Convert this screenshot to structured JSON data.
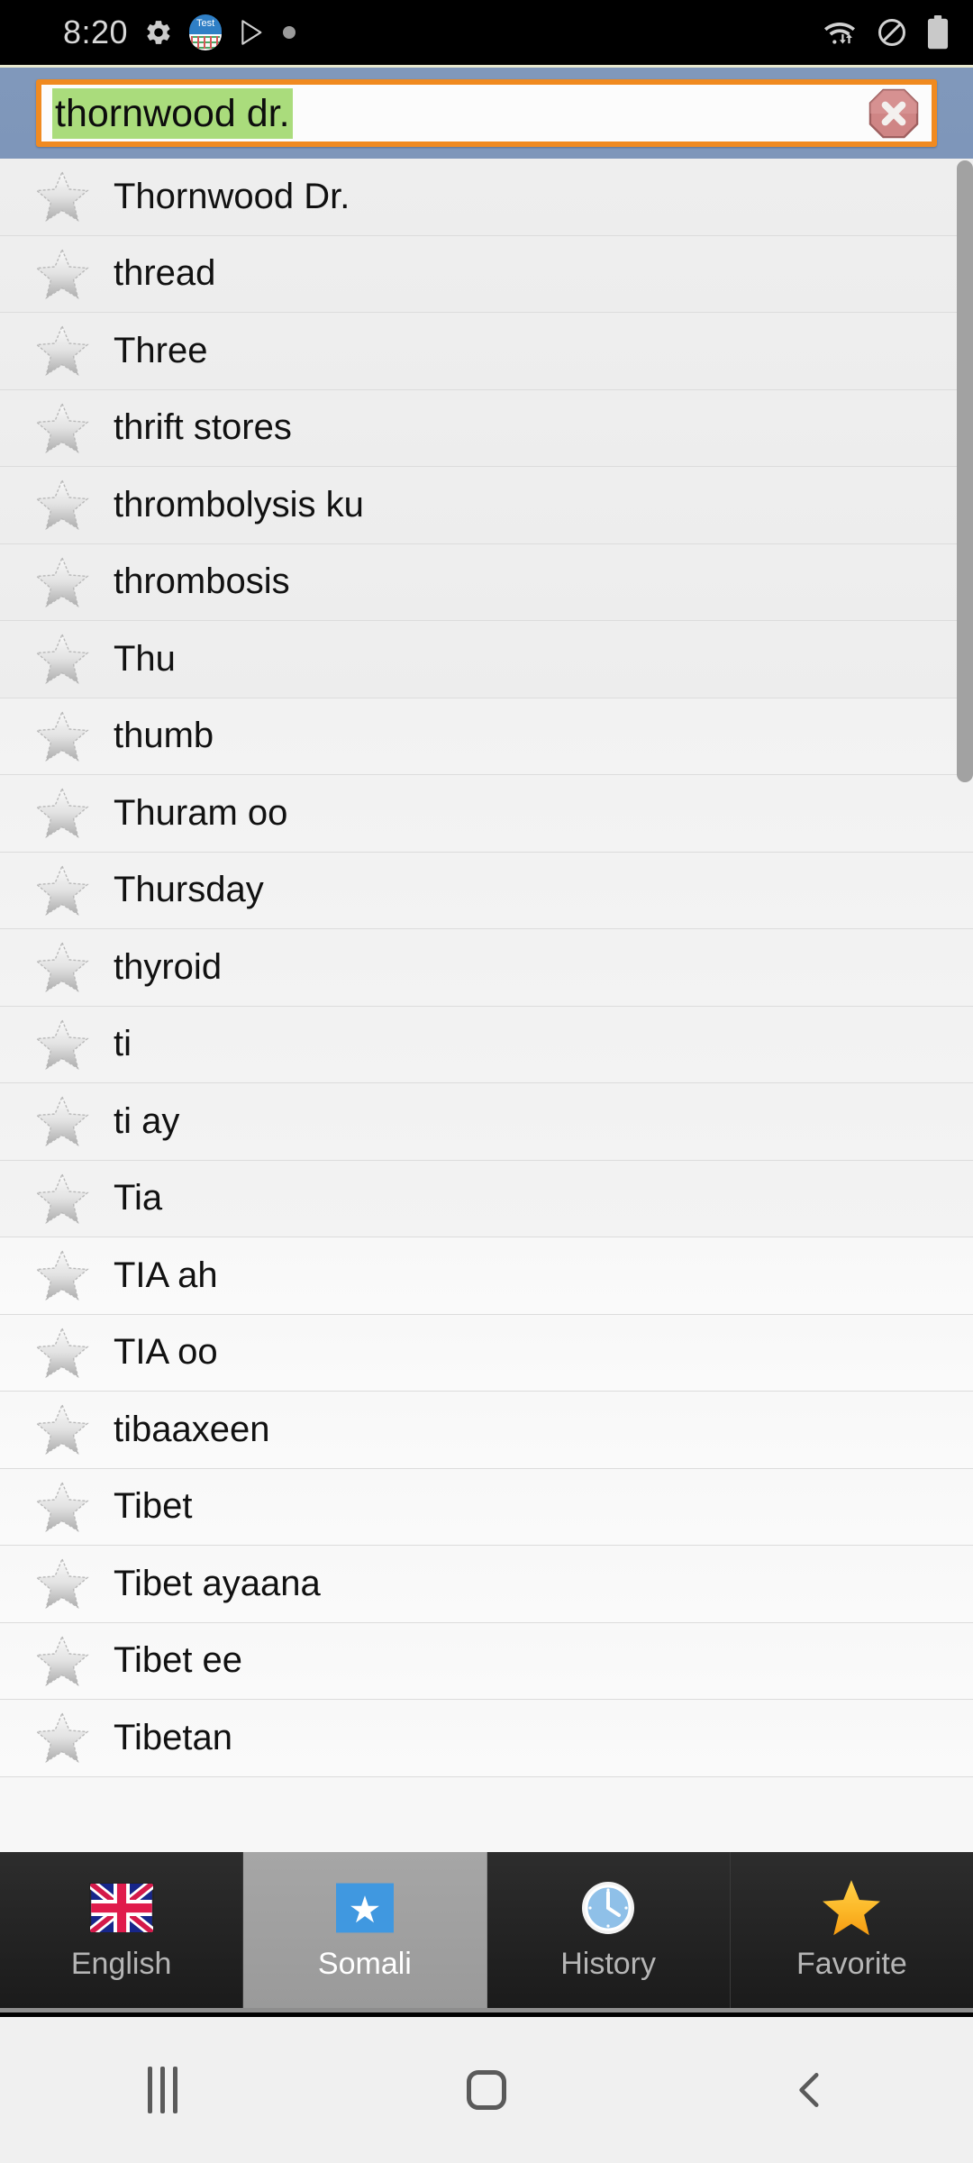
{
  "status_bar": {
    "time": "8:20",
    "left_icons": [
      "gear-icon",
      "test-app-icon",
      "play-store-icon",
      "dot-icon"
    ],
    "right_icons": [
      "wifi-icon",
      "do-not-disturb-icon",
      "battery-icon"
    ],
    "background_color": "#000000"
  },
  "search": {
    "value": "thornwood dr.",
    "placeholder": "",
    "selection_highlight_color": "#aadc7c",
    "border_color": "#f08a20",
    "header_background": "#7e96ba",
    "clear_button_label": "×",
    "clear_button_color": "#cd8484"
  },
  "list": {
    "items": [
      {
        "label": "Thornwood Dr."
      },
      {
        "label": "thread"
      },
      {
        "label": "Three"
      },
      {
        "label": "thrift stores"
      },
      {
        "label": "thrombolysis ku"
      },
      {
        "label": "thrombosis"
      },
      {
        "label": "Thu"
      },
      {
        "label": "thumb"
      },
      {
        "label": "Thuram oo"
      },
      {
        "label": "Thursday"
      },
      {
        "label": "thyroid"
      },
      {
        "label": "ti"
      },
      {
        "label": "ti ay"
      },
      {
        "label": "Tia"
      },
      {
        "label": "TIA ah"
      },
      {
        "label": "TIA oo"
      },
      {
        "label": "tibaaxeen"
      },
      {
        "label": "Tibet"
      },
      {
        "label": "Tibet ayaana"
      },
      {
        "label": "Tibet ee"
      },
      {
        "label": "Tibetan"
      }
    ],
    "row_icon": "star-outline-icon",
    "scrollbar_visible": true
  },
  "tabs": [
    {
      "label": "English",
      "icon": "uk-flag-icon",
      "selected": false
    },
    {
      "label": "Somali",
      "icon": "somalia-flag-icon",
      "selected": true
    },
    {
      "label": "History",
      "icon": "clock-icon",
      "selected": false
    },
    {
      "label": "Favorite",
      "icon": "gold-star-icon",
      "selected": false
    }
  ],
  "nav_bar": {
    "recents_label": "recents-icon",
    "home_label": "home-icon",
    "back_label": "back-icon",
    "background_color": "#f0f0f0"
  }
}
